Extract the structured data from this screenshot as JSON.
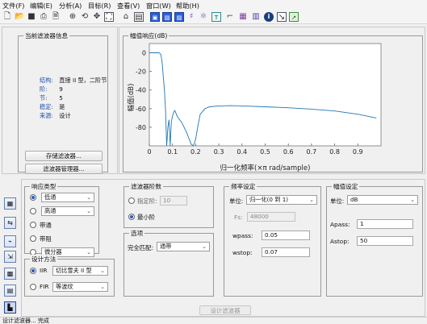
{
  "menu": [
    {
      "label": "文件(F)"
    },
    {
      "label": "编辑(E)"
    },
    {
      "label": "分析(A)"
    },
    {
      "label": "目标(R)"
    },
    {
      "label": "查看(V)"
    },
    {
      "label": "窗口(W)"
    },
    {
      "label": "帮助(H)"
    }
  ],
  "toolbar": {
    "icons": [
      "new-file-icon",
      "open-folder-icon",
      "save-icon",
      "print-icon",
      "print-preview-icon",
      "zoom-in-icon",
      "zoom-out-icon",
      "pan-icon",
      "fit-icon",
      "magnitude-response-icon",
      "phase-response-icon",
      "magnitude-phase-icon",
      "group-delay-icon",
      "phase-delay-icon",
      "impulse-response-icon",
      "step-response-icon",
      "pole-zero-icon",
      "coefficients-icon",
      "filter-info-icon",
      "zoom-box-icon",
      "export-icon"
    ]
  },
  "current_filter": {
    "title": "当前滤波器信息",
    "rows": [
      {
        "key": "结构:",
        "value": "直接 II 型，二阶节"
      },
      {
        "key": "阶:",
        "value": "9"
      },
      {
        "key": "节:",
        "value": "5"
      },
      {
        "key": "稳定:",
        "value": "是"
      },
      {
        "key": "来源:",
        "value": "设计"
      }
    ],
    "store_button": "存储滤波器...",
    "manager_button": "滤波器管理器..."
  },
  "magnitude_panel": {
    "title": "幅值响应(dB)"
  },
  "chart_data": {
    "type": "line",
    "title": "",
    "xlabel": "归一化频率(×π rad/sample)",
    "ylabel": "幅值(dB)",
    "xlim": [
      0,
      1
    ],
    "ylim": [
      -100,
      10
    ],
    "xticks": [
      0,
      0.1,
      0.2,
      0.3,
      0.4,
      0.5,
      0.6,
      0.7,
      0.8,
      0.9
    ],
    "yticks": [
      0,
      -20,
      -40,
      -60,
      -80
    ],
    "grid": false,
    "series": [
      {
        "color": "#1f77b4",
        "x": [
          0,
          0.02,
          0.04,
          0.045,
          0.05,
          0.056,
          0.06,
          0.065,
          0.07,
          0.075,
          0.08,
          0.085,
          0.088,
          0.09,
          0.095,
          0.1,
          0.105,
          0.11,
          0.12,
          0.14,
          0.16,
          0.18,
          0.19,
          0.2,
          0.21,
          0.22,
          0.24,
          0.26,
          0.3,
          0.35,
          0.4,
          0.5,
          0.6,
          0.7,
          0.8,
          0.9,
          0.98
        ],
        "y": [
          0,
          0,
          0,
          -0.3,
          -2,
          -12,
          -25,
          -40,
          -62,
          -100,
          -80,
          -72,
          -88,
          -100,
          -74,
          -68,
          -64,
          -62,
          -68,
          -75,
          -85,
          -98,
          -100,
          -93,
          -78,
          -66,
          -60,
          -58,
          -57,
          -56.8,
          -57,
          -58,
          -59,
          -60.5,
          -62.5,
          -66,
          -70
        ]
      }
    ]
  },
  "response_type": {
    "title": "响应类型",
    "options": [
      {
        "label": "低通",
        "selected": true,
        "dropdown": "低通"
      },
      {
        "label": "高通",
        "selected": false,
        "dropdown": "高通"
      },
      {
        "label": "带通",
        "selected": false
      },
      {
        "label": "带阻",
        "selected": false
      },
      {
        "label": "微分器",
        "selected": false,
        "dropdown": "微分器"
      }
    ]
  },
  "design_method": {
    "title": "设计方法",
    "iir_label": "IIR",
    "iir_value": "切比雪夫 II 型",
    "fir_label": "FIR",
    "fir_value": "等波纹",
    "iir_selected": true
  },
  "filter_order": {
    "title": "滤波器阶数",
    "specify_label": "指定阶:",
    "specify_value": "10",
    "min_label": "最小阶",
    "min_selected": true
  },
  "options": {
    "title": "选项",
    "match_label": "完全匹配:",
    "match_value": "通带"
  },
  "freq_spec": {
    "title": "频率设定",
    "unit_label": "单位:",
    "unit_value": "归一化(0 到 1)",
    "fs_label": "Fs:",
    "fs_value": "48000",
    "wpass_label": "wpass:",
    "wpass_value": "0.05",
    "wstop_label": "wstop:",
    "wstop_value": "0.07"
  },
  "mag_spec": {
    "title": "幅值设定",
    "unit_label": "单位:",
    "unit_value": "dB",
    "apass_label": "Apass:",
    "apass_value": "1",
    "astop_label": "Astop:",
    "astop_value": "50"
  },
  "design_button": "设计滤波器",
  "status": "设计滤波器... 完成"
}
